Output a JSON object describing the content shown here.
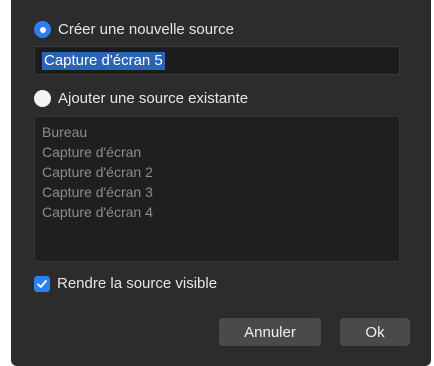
{
  "dialog": {
    "new_source": {
      "label": "Créer une nouvelle source",
      "selected": true,
      "name_value": "Capture d'écran 5"
    },
    "existing_source": {
      "label": "Ajouter une source existante",
      "selected": false,
      "items": [
        "Bureau",
        "Capture d'écran",
        "Capture d'écran 2",
        "Capture d'écran 3",
        "Capture d'écran 4"
      ]
    },
    "visible_checkbox": {
      "label": "Rendre la source visible",
      "checked": true
    },
    "buttons": {
      "cancel": "Annuler",
      "ok": "Ok"
    }
  },
  "colors": {
    "accent": "#2d7ff6",
    "background": "#2c2c2c",
    "selection": "#2b63b7"
  }
}
